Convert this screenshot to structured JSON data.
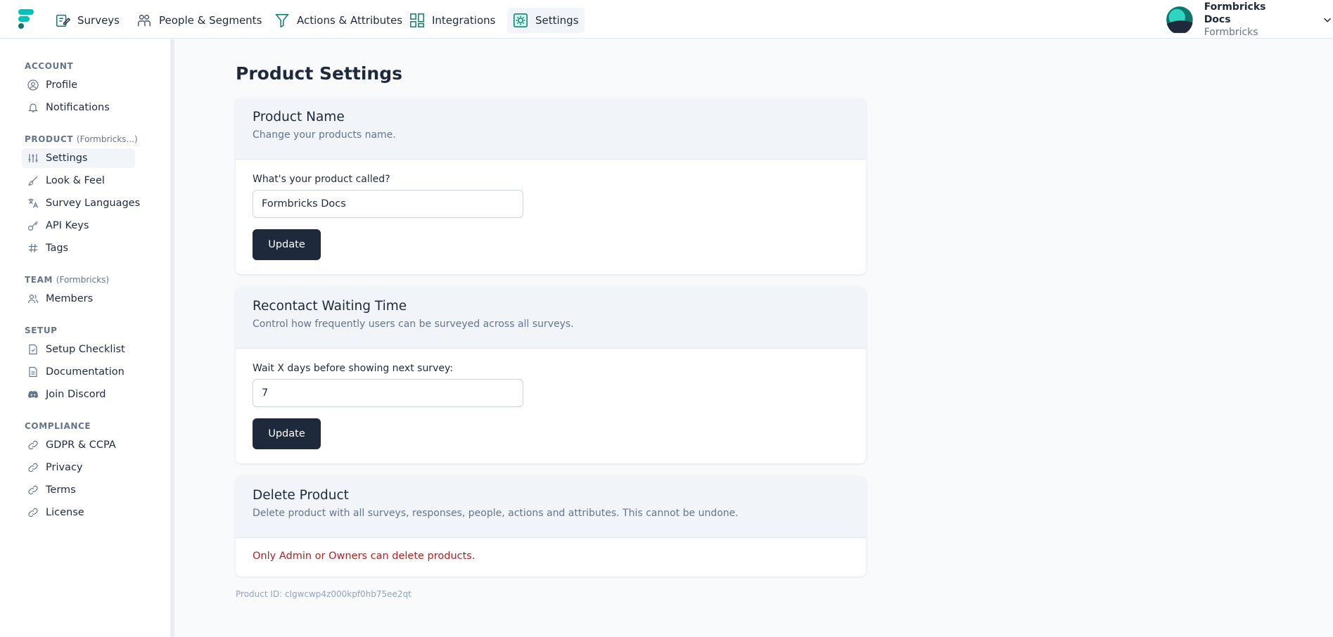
{
  "nav": {
    "items": [
      {
        "label": "Surveys",
        "icon": "survey-edit-icon"
      },
      {
        "label": "People & Segments",
        "icon": "people-icon"
      },
      {
        "label": "Actions & Attributes",
        "icon": "filter-icon"
      },
      {
        "label": "Integrations",
        "icon": "integrations-grid-icon"
      },
      {
        "label": "Settings",
        "icon": "settings-gear-icon",
        "active": true
      }
    ],
    "user": {
      "name": "Formbricks Docs",
      "org": "Formbricks"
    },
    "accent": "#00c4b8"
  },
  "sidebar": {
    "account": {
      "label": "ACCOUNT",
      "items": [
        {
          "label": "Profile"
        },
        {
          "label": "Notifications"
        }
      ]
    },
    "product": {
      "label": "PRODUCT",
      "context": "(Formbricks...)",
      "items": [
        {
          "label": "Settings"
        },
        {
          "label": "Look & Feel"
        },
        {
          "label": "Survey Languages"
        },
        {
          "label": "API Keys"
        },
        {
          "label": "Tags"
        }
      ]
    },
    "team": {
      "label": "TEAM",
      "context": "(Formbricks)",
      "items": [
        {
          "label": "Members"
        }
      ]
    },
    "setup": {
      "label": "SETUP",
      "items": [
        {
          "label": "Setup Checklist"
        },
        {
          "label": "Documentation"
        },
        {
          "label": "Join Discord"
        }
      ]
    },
    "compliance": {
      "label": "COMPLIANCE",
      "items": [
        {
          "label": "GDPR & CCPA"
        },
        {
          "label": "Privacy"
        },
        {
          "label": "Terms"
        },
        {
          "label": "License"
        }
      ]
    }
  },
  "main": {
    "title": "Product Settings",
    "product_name": {
      "title": "Product Name",
      "subtitle": "Change your products name.",
      "field_label": "What's your product called?",
      "value": "Formbricks Docs",
      "button": "Update"
    },
    "recontact": {
      "title": "Recontact Waiting Time",
      "subtitle": "Control how frequently users can be surveyed across all surveys.",
      "field_label": "Wait X days before showing next survey:",
      "value": "7",
      "button": "Update"
    },
    "delete": {
      "title": "Delete Product",
      "subtitle": "Delete product with all surveys, responses, people, actions and attributes. This cannot be undone.",
      "warning": "Only Admin or Owners can delete products."
    },
    "product_id": "Product ID: clgwcwp4z000kpf0hb75ee2qt"
  }
}
